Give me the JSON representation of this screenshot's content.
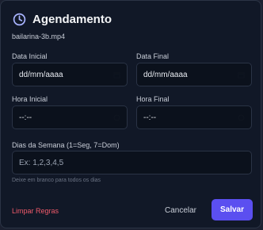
{
  "dialog": {
    "title": "Agendamento",
    "filename": "bailarina-3b.mp4",
    "icon": "clock-icon",
    "accent_color": "#5b4ff0"
  },
  "fields": {
    "start_date": {
      "label": "Data Inicial",
      "value": "dd/mm/aaaa",
      "icon": "calendar-icon"
    },
    "end_date": {
      "label": "Data Final",
      "value": "dd/mm/aaaa",
      "icon": "calendar-icon"
    },
    "start_time": {
      "label": "Hora Inicial",
      "value": "--:--",
      "icon": "clock-icon"
    },
    "end_time": {
      "label": "Hora Final",
      "value": "--:--",
      "icon": "clock-icon"
    },
    "weekdays": {
      "label": "Dias da Semana (1=Seg, 7=Dom)",
      "placeholder": "Ex: 1,2,3,4,5",
      "hint": "Deixe em branco para todos os dias"
    }
  },
  "actions": {
    "clear": "Limpar Regras",
    "cancel": "Cancelar",
    "save": "Salvar",
    "clear_color": "#f05a6a"
  }
}
